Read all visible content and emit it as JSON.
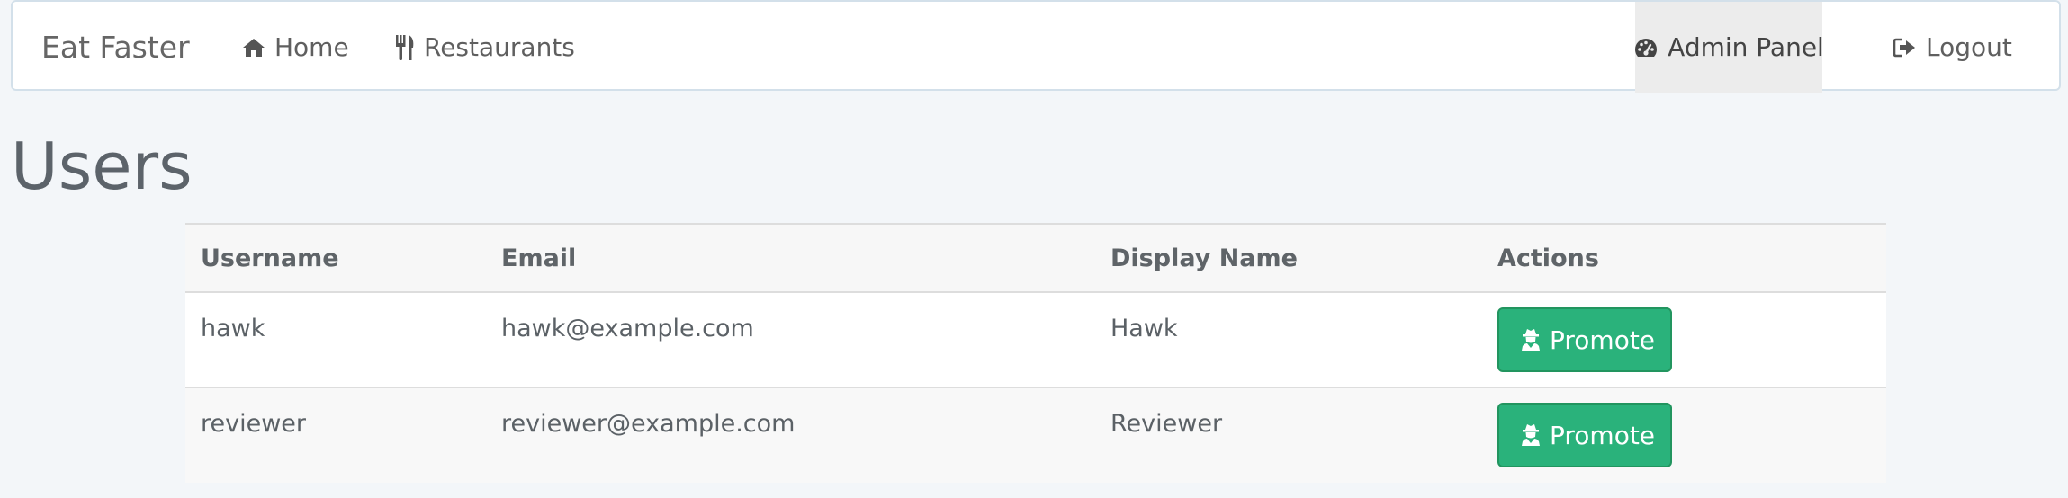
{
  "navbar": {
    "brand": "Eat Faster",
    "home_label": "Home",
    "restaurants_label": "Restaurants",
    "admin_label": "Admin Panel",
    "logout_label": "Logout"
  },
  "page": {
    "title": "Users"
  },
  "table": {
    "headers": [
      "Username",
      "Email",
      "Display Name",
      "Actions"
    ],
    "rows": [
      {
        "username": "hawk",
        "email": "hawk@example.com",
        "display_name": "Hawk",
        "action_label": "Promote"
      },
      {
        "username": "reviewer",
        "email": "reviewer@example.com",
        "display_name": "Reviewer",
        "action_label": "Promote"
      }
    ]
  },
  "colors": {
    "page_bg": "#f3f6f9",
    "promote_button": "#2ab27b",
    "admin_active_bg": "#ececec"
  },
  "icons": {
    "home": "home-icon",
    "restaurants": "cutlery-icon",
    "admin": "dashboard-icon",
    "logout": "logout-icon",
    "promote": "user-secret-icon"
  }
}
